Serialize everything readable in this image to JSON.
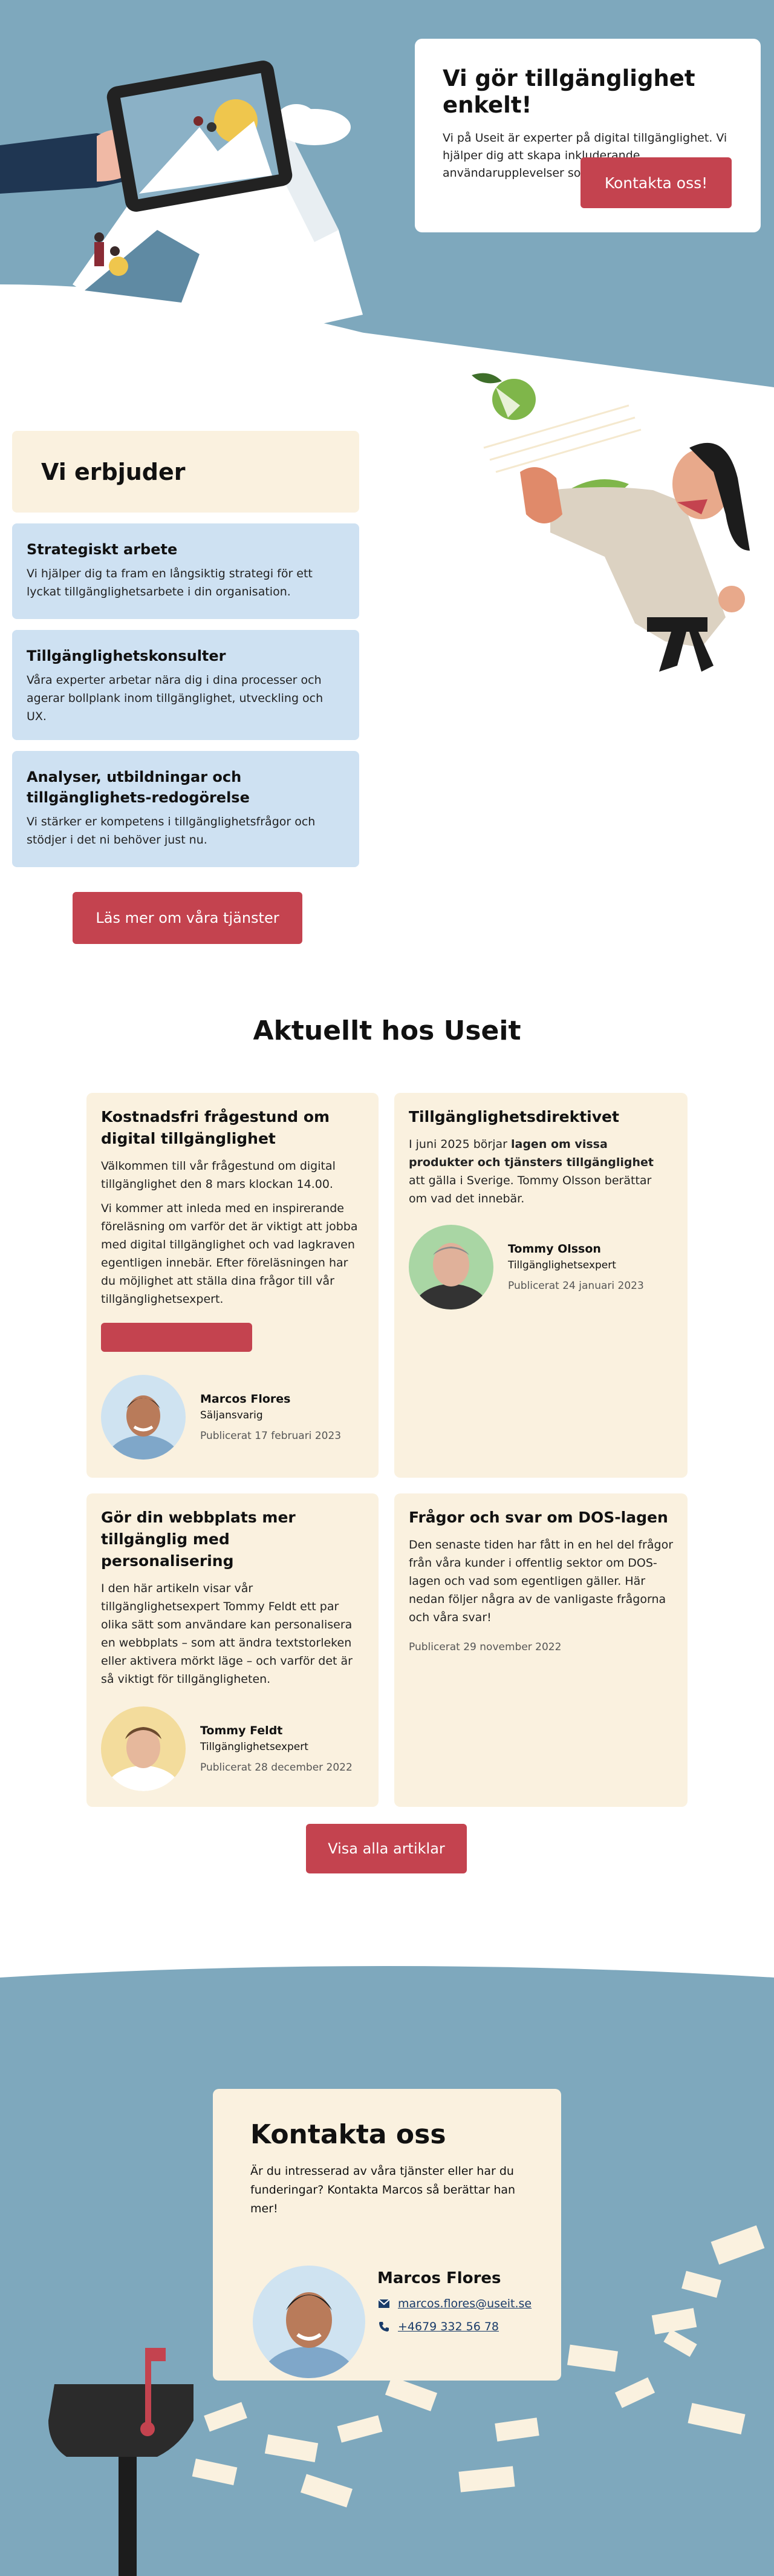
{
  "hero": {
    "title": "Vi gör tillgänglighet enkelt!",
    "text": "Vi på Useit är experter på digital tillgänglighet. Vi hjälper dig att skapa inkluderande användarupplevelser som fungerar för alla.",
    "cta": "Kontakta oss!"
  },
  "services": {
    "heading": "Vi erbjuder",
    "items": [
      {
        "title": "Strategiskt arbete",
        "text": "Vi hjälper dig ta fram en långsiktig strategi för ett lyckat tillgänglighetsarbete i din organisation."
      },
      {
        "title": "Tillgänglighetskonsulter",
        "text": "Våra experter arbetar nära dig i dina processer och agerar bollplank inom tillgänglighet, utveckling och UX."
      },
      {
        "title": "Analyser, utbildningar och tillgänglighets-redogörelse",
        "text": "Vi stärker er kompetens i tillgänglighetsfrågor och stödjer i det ni behöver just nu."
      }
    ],
    "cta": "Läs mer om våra tjänster"
  },
  "news": {
    "heading": "Aktuellt hos Useit",
    "articles": [
      {
        "title": "Kostnadsfri frågestund om digital tillgänglighet",
        "text1": "Välkommen till vår frågestund om digital tillgänglighet den 8 mars klockan 14.00.",
        "text2": "Vi kommer att inleda med en inspirerande föreläsning om varför det är viktigt att jobba med digital tillgänglighet och vad lagkraven egentligen innebär. Efter föreläsningen har du möjlighet att ställa dina frågor till vår tillgänglighetsexpert.",
        "author": "Marcos Flores",
        "role": "Säljansvarig",
        "date": "Publicerat 17 februari 2023"
      },
      {
        "title": "Tillgänglighetsdirektivet",
        "text_a": "I juni 2025 börjar ",
        "text_b": "lagen om vissa produkter och tjänsters tillgänglighet",
        "text_c": " att gälla i Sverige. Tommy Olsson berättar om vad det innebär.",
        "author": "Tommy Olsson",
        "role": "Tillgänglighetsexpert",
        "date": "Publicerat 24 januari 2023"
      },
      {
        "title": "Gör din webbplats mer tillgänglig med personalisering",
        "text": "I den här artikeln visar vår tillgänglighetsexpert Tommy Feldt ett par olika sätt som användare kan personalisera en webbplats – som att ändra textstorleken eller aktivera mörkt läge – och varför det är så viktigt för tillgängligheten.",
        "author": "Tommy Feldt",
        "role": "Tillgänglighetsexpert",
        "date": "Publicerat 28 december 2022"
      },
      {
        "title": "Frågor och svar om DOS-lagen",
        "text": "Den senaste tiden har fått in en hel del frågor från våra kunder i offentlig sektor om DOS-lagen och vad som egentligen gäller. Här nedan följer några av de vanligaste frågorna och våra svar!",
        "date": "Publicerat 29 november 2022"
      }
    ],
    "cta": "Visa alla artiklar"
  },
  "contact": {
    "heading": "Kontakta oss",
    "text": "Är du intresserad av våra tjänster eller har du funderingar? Kontakta Marcos så berättar han mer!",
    "name": "Marcos Flores",
    "email": "marcos.flores@useit.se",
    "phone": "+4679 332 56 78"
  },
  "colors": {
    "accent": "#c4434f",
    "sky": "#7ea8bd",
    "cream": "#faf1df",
    "light_blue": "#cee1f2"
  },
  "icons": [
    "email-icon",
    "phone-icon"
  ]
}
